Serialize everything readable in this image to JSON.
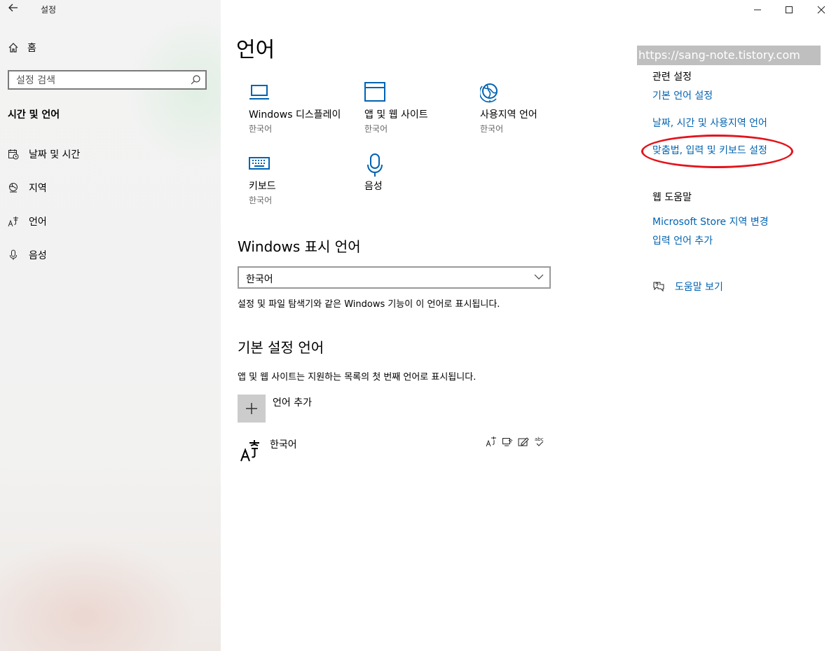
{
  "window": {
    "title": "설정"
  },
  "sidebar": {
    "home_label": "홈",
    "search_placeholder": "설정 검색",
    "section_title": "시간 및 언어",
    "items": [
      {
        "label": "날짜 및 시간",
        "icon": "calendar-clock-icon"
      },
      {
        "label": "지역",
        "icon": "region-globe-icon"
      },
      {
        "label": "언어",
        "icon": "language-icon"
      },
      {
        "label": "음성",
        "icon": "microphone-icon"
      }
    ]
  },
  "main": {
    "title": "언어",
    "tiles": [
      {
        "label": "Windows 디스플레이",
        "sub": "한국어",
        "icon": "laptop-icon"
      },
      {
        "label": "앱 및 웹 사이트",
        "sub": "한국어",
        "icon": "browser-window-icon"
      },
      {
        "label": "사용지역 언어",
        "sub": "한국어",
        "icon": "globe-icon"
      },
      {
        "label": "키보드",
        "sub": "한국어",
        "icon": "keyboard-icon"
      },
      {
        "label": "음성",
        "sub": "",
        "icon": "microphone-icon"
      }
    ],
    "display_language": {
      "heading": "Windows 표시 언어",
      "selected": "한국어",
      "description": "설정 및 파일 탐색기와 같은 Windows 기능이 이 언어로 표시됩니다."
    },
    "preferred": {
      "heading": "기본 설정 언어",
      "description": "앱 및 웹 사이트는 지원하는 목록의 첫 번째 언어로 표시됩니다.",
      "add_label": "언어 추가",
      "languages": [
        {
          "name": "한국어"
        }
      ]
    }
  },
  "related": {
    "watermark": "https://sang-note.tistory.com",
    "heading": "관련 설정",
    "links": [
      "기본 언어 설정",
      "날짜, 시간 및 사용지역 언어",
      "맞춤법, 입력 및 키보드 설정"
    ],
    "web_help_heading": "웹 도움말",
    "web_links": [
      "Microsoft Store 지역 변경",
      "입력 언어 추가"
    ],
    "help_label": "도움말 보기"
  },
  "colors": {
    "accent": "#0063b1",
    "highlight_oval": "#e3141b"
  }
}
